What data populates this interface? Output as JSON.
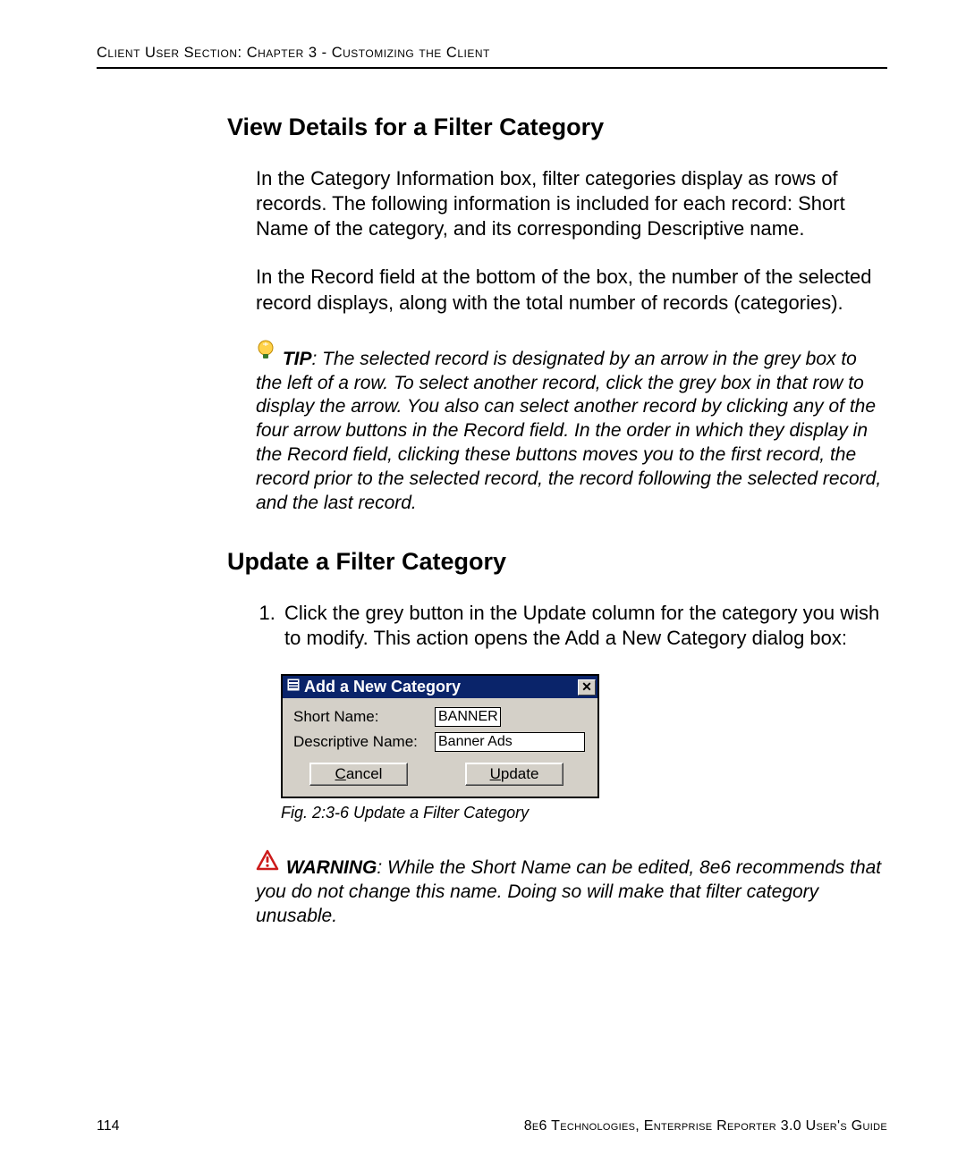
{
  "header": {
    "running": "Client User Section: Chapter 3 - Customizing the Client"
  },
  "section1": {
    "title": "View Details for a Filter Category",
    "para1": "In the Category Information box, filter categories display as rows of records. The following information is included for each record: Short Name of the category, and its corresponding Descriptive name.",
    "para2": "In the Record field at the bottom of the box, the number of the selected record displays, along with the total number of records (categories).",
    "tip_label": "TIP",
    "tip_text": ": The selected record is designated by an arrow in the grey box to the left of a row. To select another record, click the grey box in that row to display the arrow. You also can select another record by clicking any of the four arrow buttons in the Record field. In the order in which they display in the Record field, clicking these buttons moves you to the first record, the record prior to the selected record, the record following the selected record, and the last record."
  },
  "section2": {
    "title": "Update a Filter Category",
    "step1": "Click the grey button in the Update column for the category you wish to modify. This action opens the Add a New Category dialog box:"
  },
  "dialog": {
    "title": "Add a New Category",
    "close": "✕",
    "label_short": "Short Name:",
    "label_desc": "Descriptive Name:",
    "value_short": "BANNER",
    "value_desc": "Banner Ads",
    "btn_cancel": "Cancel",
    "btn_update": "Update"
  },
  "caption": "Fig. 2:3-6  Update a Filter Category",
  "warning": {
    "label": "WARNING",
    "text": ": While the Short Name can be edited, 8e6 recommends that you do not change this name. Doing so will make that filter category unusable."
  },
  "footer": {
    "page": "114",
    "right": "8e6 Technologies, Enterprise Reporter 3.0 User's Guide"
  }
}
